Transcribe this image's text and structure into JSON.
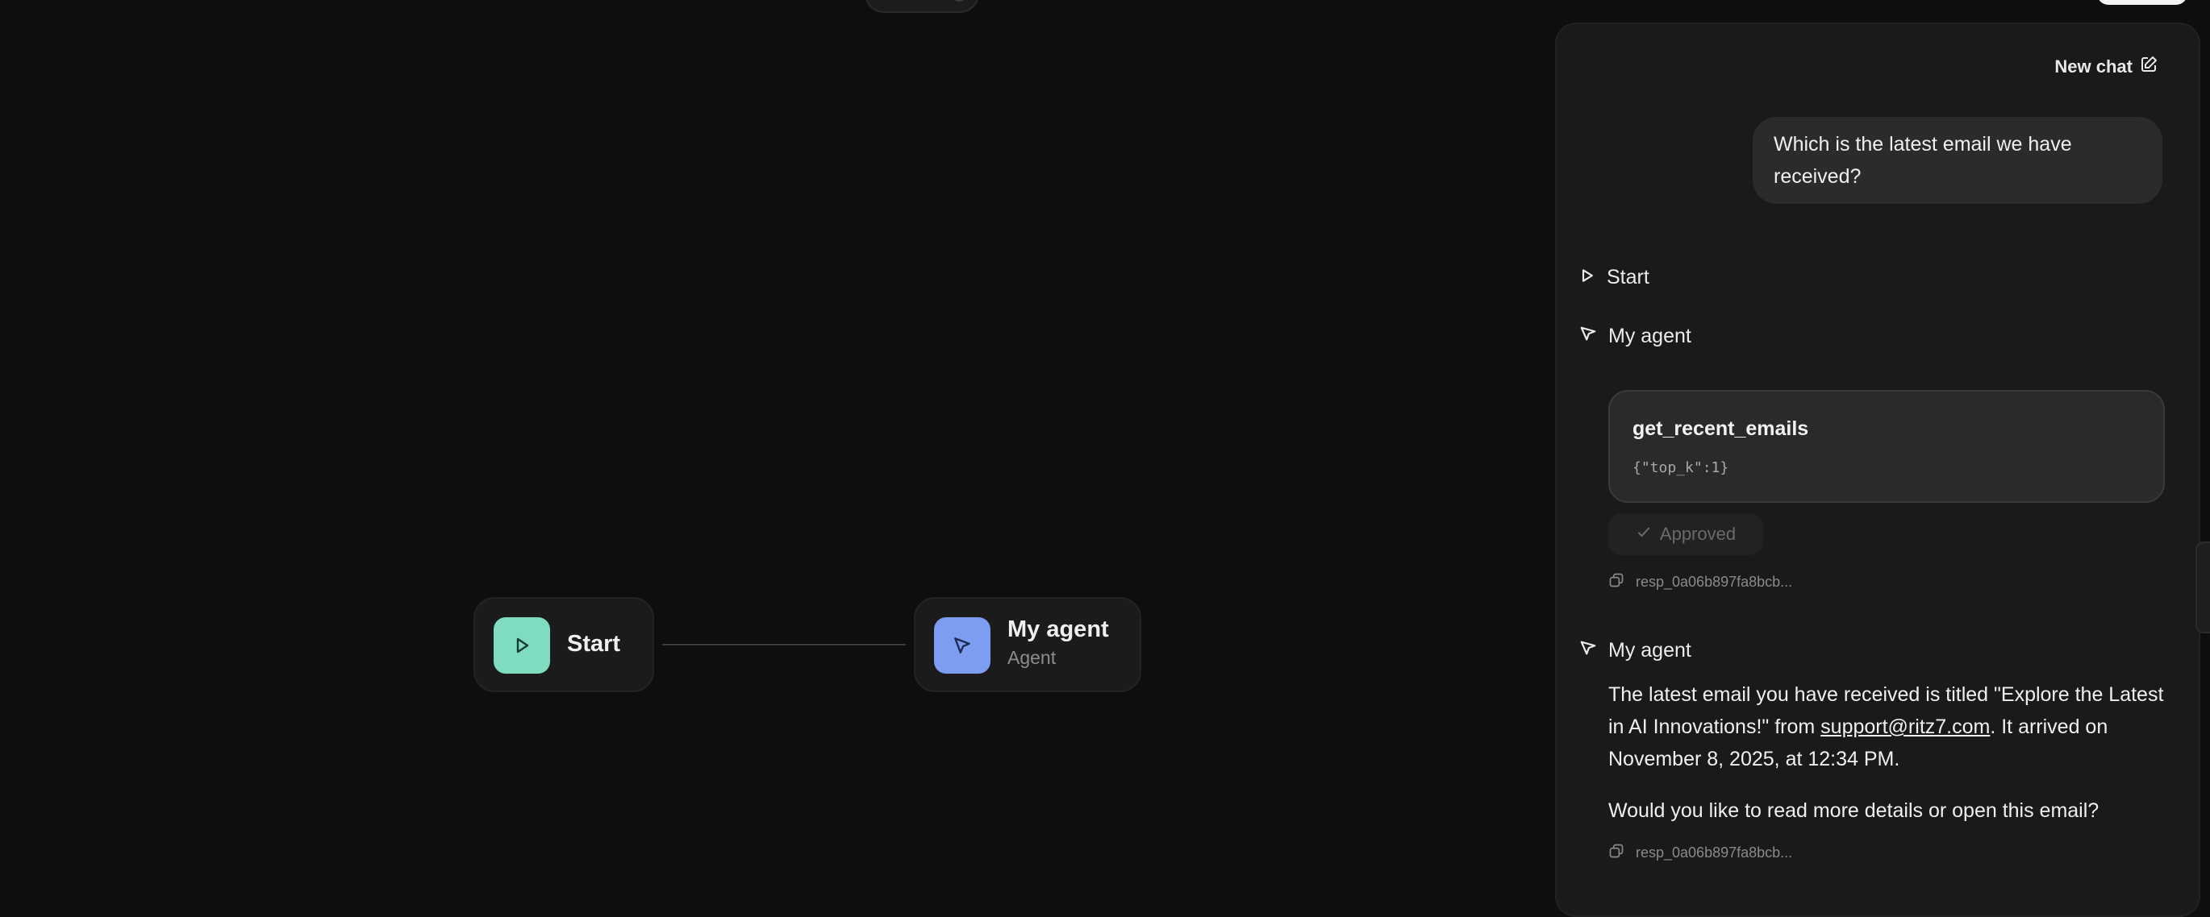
{
  "canvas": {
    "nodes": [
      {
        "title": "Start",
        "subtitle": "",
        "icon": "play-icon",
        "color": "#7fdcc0"
      },
      {
        "title": "My agent",
        "subtitle": "Agent",
        "icon": "cursor-icon",
        "color": "#7c9df0"
      }
    ]
  },
  "chat": {
    "new_chat_label": "New chat",
    "user_message": "Which is the latest email we have received?",
    "steps": {
      "start": "Start",
      "agent_1": "My agent",
      "agent_2": "My agent"
    },
    "tool_call": {
      "name": "get_recent_emails",
      "args": "{\"top_k\":1}",
      "status": "Approved"
    },
    "resp_id_1": "resp_0a06b897fa8bcb...",
    "resp_id_2": "resp_0a06b897fa8bcb...",
    "assistant": {
      "p1_before": "The latest email you have received is titled \"Explore the Latest in AI Innovations!\" from ",
      "p1_link": "support@ritz7.com",
      "p1_after": ". It arrived on November 8, 2025, at 12:34 PM.",
      "p2": "Would you like to read more details or open this email?"
    }
  }
}
